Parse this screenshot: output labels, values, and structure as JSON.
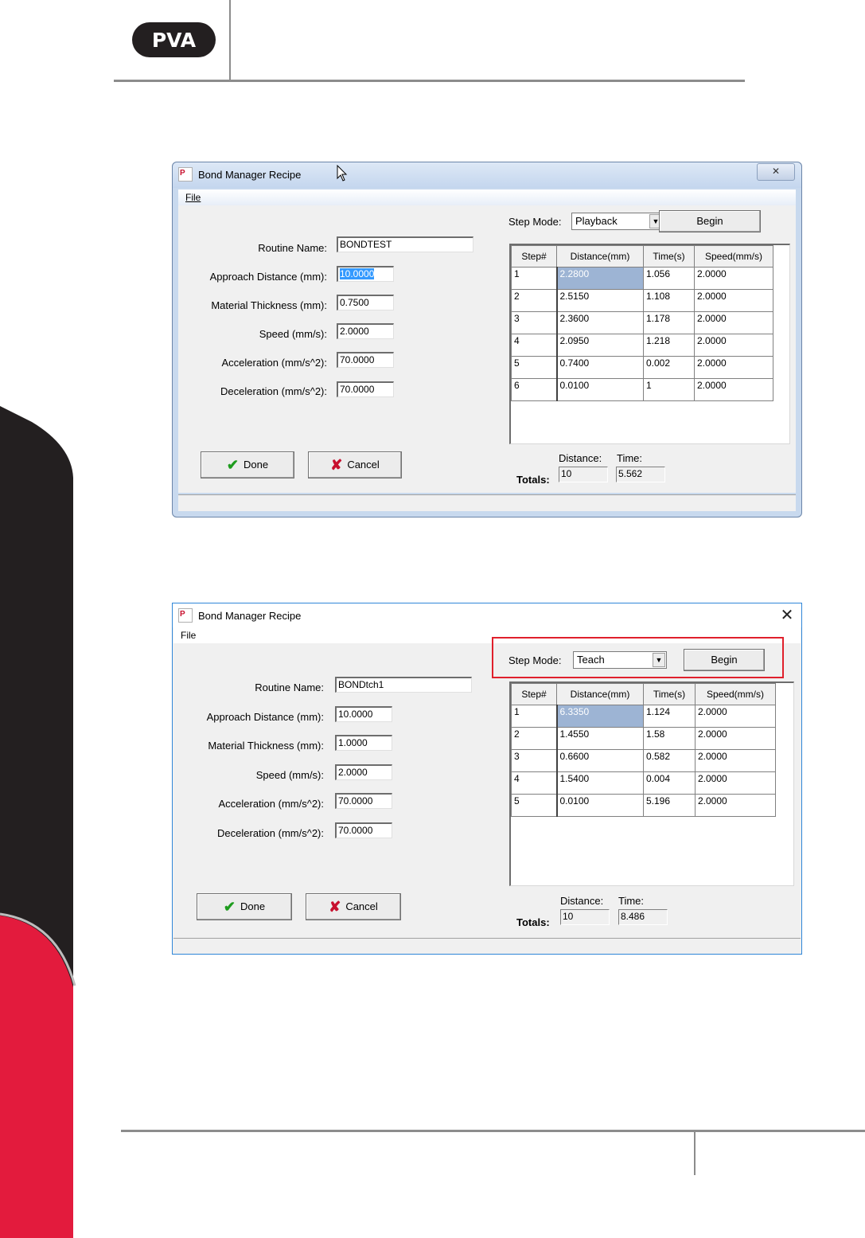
{
  "brand": {
    "logo_text": "PVA",
    "accent": "#e31b3d",
    "dark": "#231f20"
  },
  "dialogs": [
    {
      "title": "Bond Manager Recipe",
      "menu_file": "File",
      "labels": {
        "routine_name": "Routine Name:",
        "approach": "Approach Distance (mm):",
        "thickness": "Material Thickness (mm):",
        "speed": "Speed (mm/s):",
        "accel": "Acceleration (mm/s^2):",
        "decel": "Deceleration (mm/s^2):"
      },
      "values": {
        "routine_name": "BONDTEST",
        "approach": "10.0000",
        "thickness": "0.7500",
        "speed": "2.0000",
        "accel": "70.0000",
        "decel": "70.0000"
      },
      "step_mode_label": "Step Mode:",
      "step_mode_value": "Playback",
      "begin": "Begin",
      "columns": [
        "Step#",
        "Distance(mm)",
        "Time(s)",
        "Speed(mm/s)"
      ],
      "rows": [
        [
          "1",
          "2.2800",
          "1.056",
          "2.0000"
        ],
        [
          "2",
          "2.5150",
          "1.108",
          "2.0000"
        ],
        [
          "3",
          "2.3600",
          "1.178",
          "2.0000"
        ],
        [
          "4",
          "2.0950",
          "1.218",
          "2.0000"
        ],
        [
          "5",
          "0.7400",
          "0.002",
          "2.0000"
        ],
        [
          "6",
          "0.0100",
          "1",
          "2.0000"
        ]
      ],
      "done": "Done",
      "cancel": "Cancel",
      "totals_label": "Totals:",
      "distance_label": "Distance:",
      "time_label": "Time:",
      "total_distance": "10",
      "total_time": "5.562"
    },
    {
      "title": "Bond Manager Recipe",
      "menu_file": "File",
      "labels": {
        "routine_name": "Routine Name:",
        "approach": "Approach Distance (mm):",
        "thickness": "Material Thickness (mm):",
        "speed": "Speed (mm/s):",
        "accel": "Acceleration (mm/s^2):",
        "decel": "Deceleration (mm/s^2):"
      },
      "values": {
        "routine_name": "BONDtch1",
        "approach": "10.0000",
        "thickness": "1.0000",
        "speed": "2.0000",
        "accel": "70.0000",
        "decel": "70.0000"
      },
      "step_mode_label": "Step Mode:",
      "step_mode_value": "Teach",
      "begin": "Begin",
      "columns": [
        "Step#",
        "Distance(mm)",
        "Time(s)",
        "Speed(mm/s)"
      ],
      "rows": [
        [
          "1",
          "6.3350",
          "1.124",
          "2.0000"
        ],
        [
          "2",
          "1.4550",
          "1.58",
          "2.0000"
        ],
        [
          "3",
          "0.6600",
          "0.582",
          "2.0000"
        ],
        [
          "4",
          "1.5400",
          "0.004",
          "2.0000"
        ],
        [
          "5",
          "0.0100",
          "5.196",
          "2.0000"
        ]
      ],
      "done": "Done",
      "cancel": "Cancel",
      "totals_label": "Totals:",
      "distance_label": "Distance:",
      "time_label": "Time:",
      "total_distance": "10",
      "total_time": "8.486"
    }
  ]
}
